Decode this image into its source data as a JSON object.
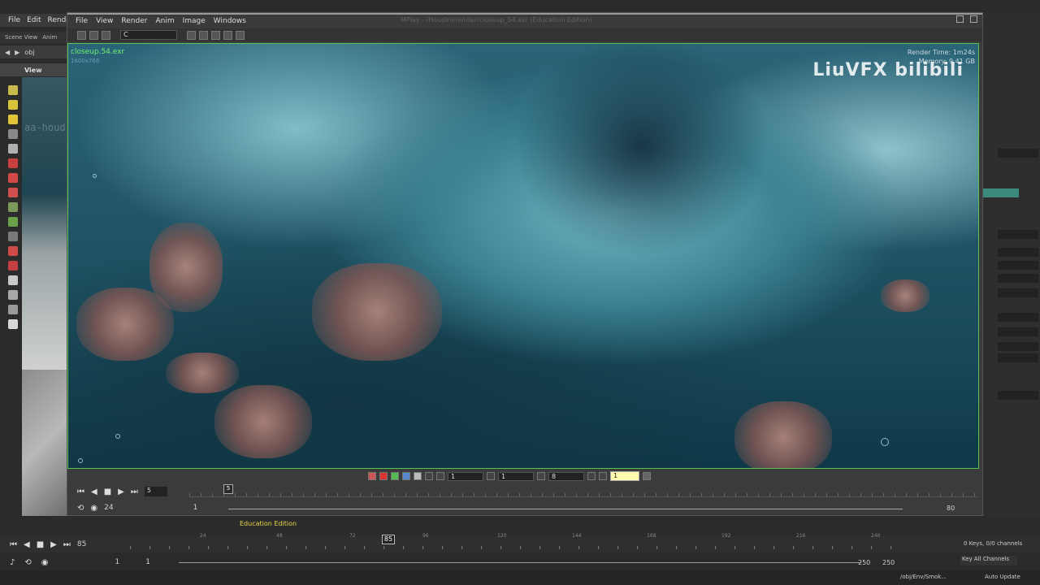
{
  "main_menu": [
    "File",
    "Edit",
    "Render"
  ],
  "scene_tabs": [
    "Scene View",
    "Anim"
  ],
  "obj_label": "obj",
  "view_label": "View",
  "left_watermark": "aa-houdini.com",
  "mplay": {
    "menu": [
      "File",
      "View",
      "Render",
      "Anim",
      "Image",
      "Windows"
    ],
    "title": "MPlay - /Houdini/render/closeup_54.exr (Education Edition)",
    "sequence_field": "C",
    "render_name": "closeup.54.exr",
    "render_res": "1600x768",
    "render_time_label": "Render Time:",
    "render_time_value": "1m24s",
    "memory_label": "Memory:",
    "memory_value": "9.41 GB",
    "watermark": "LiuVFX bilibili",
    "ctrl_value_1": "1",
    "ctrl_value_2": "1",
    "ctrl_value_3": "8",
    "ctrl_value_4": "1",
    "frame": "5",
    "fps": "24",
    "cursor_frame": "5",
    "range_start": "1",
    "range_end": "80"
  },
  "education_label": "Education Edition",
  "timeline": {
    "current_frame": "85",
    "cursor_frame": "85",
    "ticks": [
      "24",
      "48",
      "72",
      "96",
      "120",
      "144",
      "168",
      "192",
      "216",
      "240"
    ],
    "range_start_a": "1",
    "range_start_b": "1",
    "range_end_a": "250",
    "range_end_b": "250",
    "keys_info": "0 Keys, 0/0 channels",
    "key_channels": "Key All Channels"
  },
  "status": {
    "obj_path": "/obj/Env/Smok...",
    "auto_update": "Auto Update"
  },
  "colors": {
    "viewport_border": "#55c255",
    "render_name": "#6ef06e",
    "education": "#e6d84a",
    "yellow_field": "#fffcb0"
  }
}
